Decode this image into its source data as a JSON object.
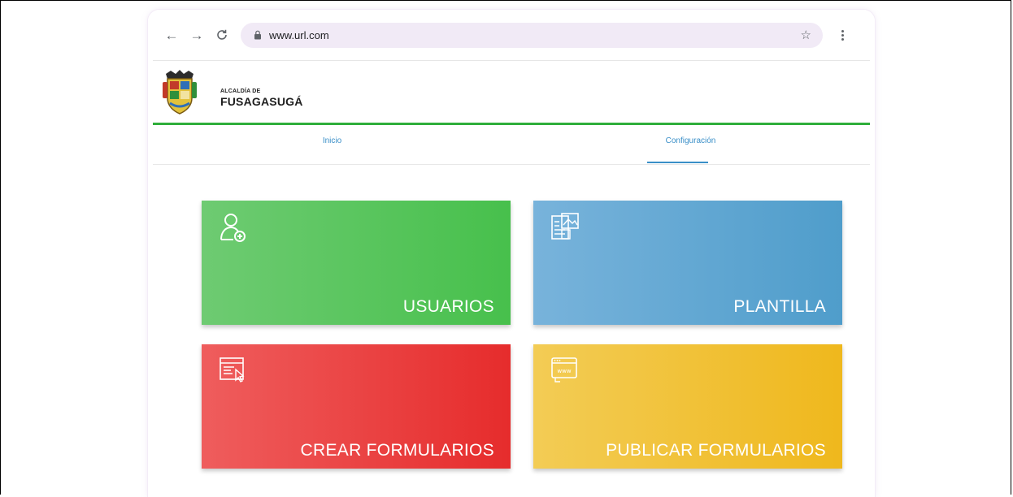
{
  "browser": {
    "url": "www.url.com"
  },
  "site": {
    "brand_small": "ALCALDÍA DE",
    "brand_big": "FUSAGASUGÁ"
  },
  "tabs": [
    {
      "label": "Inicio"
    },
    {
      "label": "Configuración"
    }
  ],
  "tiles": [
    {
      "label": "USUARIOS",
      "icon": "add-user-icon"
    },
    {
      "label": "PLANTILLA",
      "icon": "template-icon"
    },
    {
      "label": "CREAR FORMULARIOS",
      "icon": "form-create-icon"
    },
    {
      "label": "PUBLICAR FORMULARIOS",
      "icon": "web-publish-icon"
    }
  ],
  "colors": {
    "green_bar": "#2fae3a",
    "tab_accent": "#3a8fc8",
    "usuarios": "#47c04c",
    "plantilla": "#4f9dcb",
    "crear": "#e62c2c",
    "publicar": "#efb81d"
  }
}
